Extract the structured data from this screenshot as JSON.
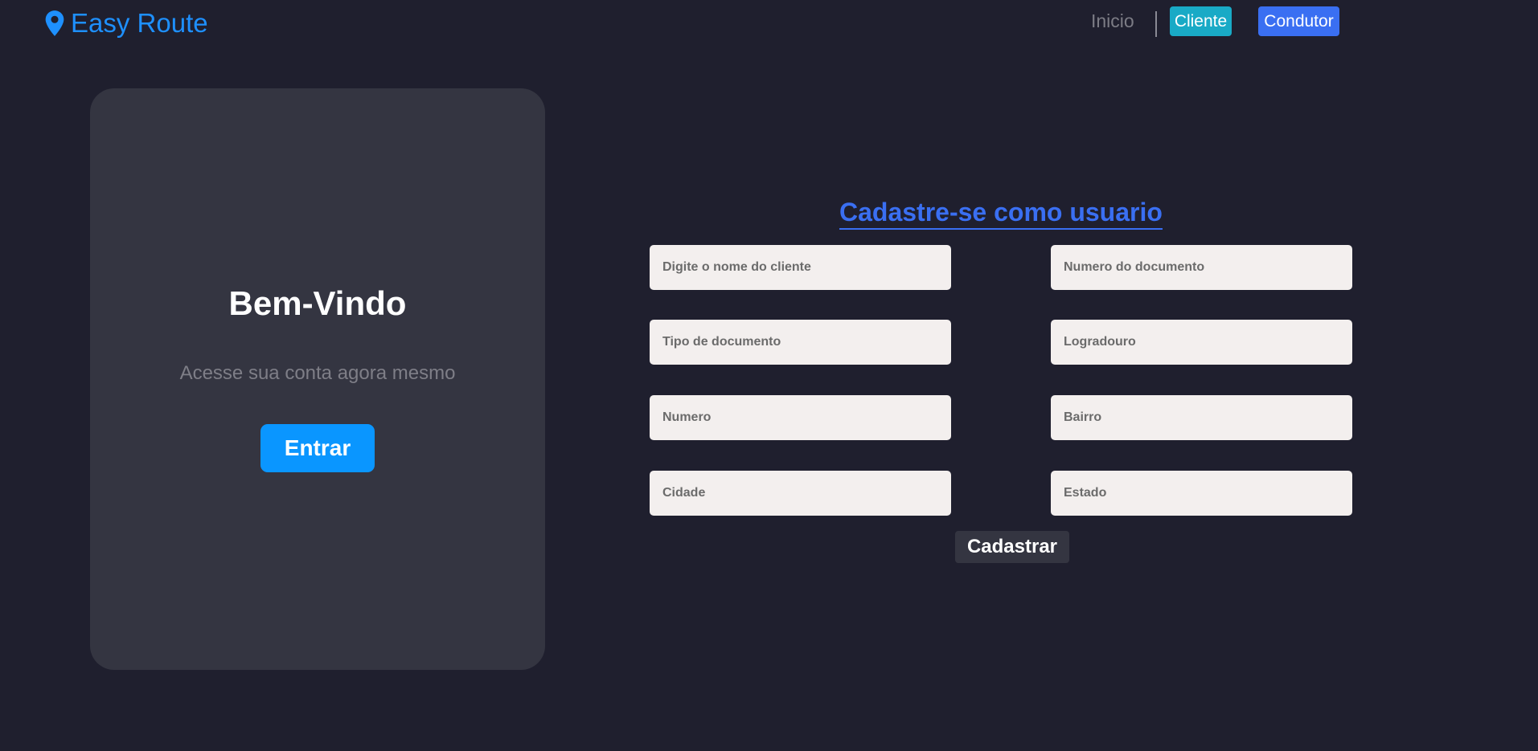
{
  "header": {
    "brand_name": "Easy Route",
    "brand_icon": "map-pin-icon",
    "nav": {
      "inicio": "Inicio",
      "cliente": "Cliente",
      "condutor": "Condutor"
    }
  },
  "welcome": {
    "title": "Bem-Vindo",
    "subtitle": "Acesse sua conta agora mesmo",
    "enter_label": "Entrar"
  },
  "form": {
    "title": "Cadastre-se como usuario",
    "fields": {
      "nome_cliente": {
        "placeholder": "Digite o nome do cliente",
        "value": ""
      },
      "numero_documento": {
        "placeholder": "Numero do documento",
        "value": ""
      },
      "tipo_documento": {
        "placeholder": "Tipo de documento",
        "value": ""
      },
      "logradouro": {
        "placeholder": "Logradouro",
        "value": ""
      },
      "numero": {
        "placeholder": "Numero",
        "value": ""
      },
      "bairro": {
        "placeholder": "Bairro",
        "value": ""
      },
      "cidade": {
        "placeholder": "Cidade",
        "value": ""
      },
      "estado": {
        "placeholder": "Estado",
        "value": ""
      }
    },
    "submit_label": "Cadastrar"
  },
  "colors": {
    "background": "#1f1f2e",
    "card": "#343541",
    "brand": "#1e90ff",
    "primary": "#3a6ff2",
    "cliente_btn": "#19aac6",
    "enter_btn": "#0a96ff",
    "field_bg": "#f3efee"
  }
}
